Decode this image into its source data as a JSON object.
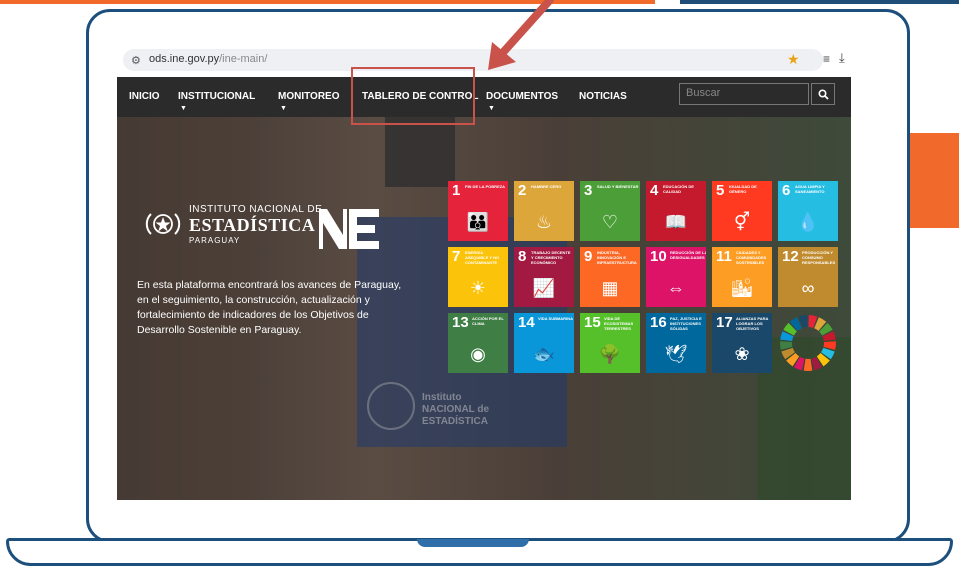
{
  "browser": {
    "url_host": "ods.ine.gov.py",
    "url_path": "/ine-main/"
  },
  "nav": {
    "items": [
      {
        "label": "INICIO",
        "has_caret": false
      },
      {
        "label": "INSTITUCIONAL",
        "has_caret": true
      },
      {
        "label": "MONITOREO",
        "has_caret": true
      },
      {
        "label": "TABLERO DE CONTROL",
        "has_caret": false
      },
      {
        "label": "DOCUMENTOS",
        "has_caret": true
      },
      {
        "label": "NOTICIAS",
        "has_caret": false
      }
    ],
    "caret_glyph": "▼",
    "search_placeholder": "Buscar"
  },
  "logo": {
    "line1": "INSTITUTO NACIONAL DE",
    "line2": "ESTADÍSTICA",
    "line3": "PARAGUAY"
  },
  "hero": {
    "description": "En esta plataforma encontrará los avances de Paraguay, en el seguimiento, la construcción, actualización y fortalecimiento de indicadores de los Objetivos de Desarrollo Sostenible en Paraguay."
  },
  "background_sign": {
    "line1": "Instituto",
    "line2": "NACIONAL de",
    "line3": "ESTADÍSTICA"
  },
  "sdg_tiles": [
    {
      "num": "1",
      "title": "Fin de la pobreza",
      "color": "#e5243b",
      "icon": "people-icon",
      "glyph": "👪"
    },
    {
      "num": "2",
      "title": "Hambre cero",
      "color": "#dda63a",
      "icon": "bowl-icon",
      "glyph": "♨"
    },
    {
      "num": "3",
      "title": "Salud y bienestar",
      "color": "#4c9f38",
      "icon": "heartbeat-icon",
      "glyph": "♡"
    },
    {
      "num": "4",
      "title": "Educación de calidad",
      "color": "#c5192d",
      "icon": "book-icon",
      "glyph": "📖"
    },
    {
      "num": "5",
      "title": "Igualdad de género",
      "color": "#ff3a21",
      "icon": "gender-icon",
      "glyph": "⚥"
    },
    {
      "num": "6",
      "title": "Agua limpia y saneamiento",
      "color": "#26bde2",
      "icon": "water-icon",
      "glyph": "💧"
    },
    {
      "num": "7",
      "title": "Energía asequible y no contaminante",
      "color": "#fcc30b",
      "icon": "sun-icon",
      "glyph": "☀"
    },
    {
      "num": "8",
      "title": "Trabajo decente y crecimiento económico",
      "color": "#a21942",
      "icon": "growth-icon",
      "glyph": "📈"
    },
    {
      "num": "9",
      "title": "Industria, innovación e infraestructura",
      "color": "#fd6925",
      "icon": "cubes-icon",
      "glyph": "▦"
    },
    {
      "num": "10",
      "title": "Reducción de las desigualdades",
      "color": "#dd1367",
      "icon": "equal-icon",
      "glyph": "⇔"
    },
    {
      "num": "11",
      "title": "Ciudades y comunidades sostenibles",
      "color": "#fd9d24",
      "icon": "city-icon",
      "glyph": "🏙"
    },
    {
      "num": "12",
      "title": "Producción y consumo responsables",
      "color": "#bf8b2e",
      "icon": "infinity-icon",
      "glyph": "∞"
    },
    {
      "num": "13",
      "title": "Acción por el clima",
      "color": "#3f7e44",
      "icon": "eye-globe-icon",
      "glyph": "◉"
    },
    {
      "num": "14",
      "title": "Vida submarina",
      "color": "#0a97d9",
      "icon": "fish-icon",
      "glyph": "🐟"
    },
    {
      "num": "15",
      "title": "Vida de ecosistemas terrestres",
      "color": "#56c02b",
      "icon": "tree-icon",
      "glyph": "🌳"
    },
    {
      "num": "16",
      "title": "Paz, justicia e instituciones sólidas",
      "color": "#00689d",
      "icon": "dove-icon",
      "glyph": "🕊"
    },
    {
      "num": "17",
      "title": "Alianzas para lograr los objetivos",
      "color": "#19486a",
      "icon": "rings-icon",
      "glyph": "❀"
    }
  ],
  "colors": {
    "accent_orange": "#f26a2b",
    "frame_blue": "#1d4f7c",
    "annotation_red": "#c9524b",
    "navbar_bg": "#2b2b2b"
  }
}
